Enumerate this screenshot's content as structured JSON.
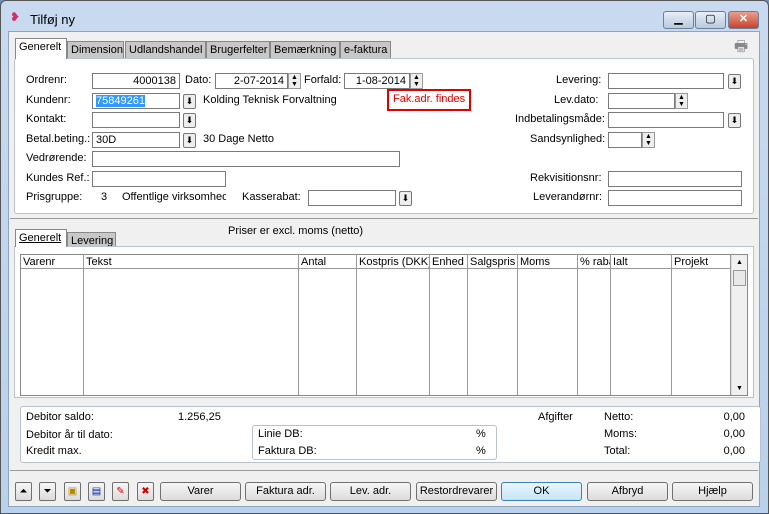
{
  "window": {
    "title": "Tilføj ny",
    "minimize": "▁",
    "maximize": "▢",
    "close": "✕"
  },
  "top_tabs": [
    "Generelt",
    "Dimension",
    "Udlandshandel",
    "Brugerfelter",
    "Bemærkning",
    "e-faktura"
  ],
  "form": {
    "ordrenr_label": "Ordrenr:",
    "ordrenr": "4000138",
    "dato_label": "Dato:",
    "dato": "2-07-2014",
    "forfald_label": "Forfald:",
    "forfald": "1-08-2014",
    "kundenr_label": "Kundenr:",
    "kundenr": "75849261",
    "kunde_navn": "Kolding Teknisk Forvaltning",
    "fak_adr": "Fak.adr. findes",
    "kontakt_label": "Kontakt:",
    "kontakt": "",
    "betal_label": "Betal.beting.:",
    "betal": "30D",
    "betal_tekst": "30 Dage Netto",
    "vedr_label": "Vedrørende:",
    "vedr": "",
    "kref_label": "Kundes Ref.:",
    "kref": "",
    "prisgruppe_label": "Prisgruppe:",
    "prisgruppe": "3",
    "prisgruppe_tekst": "Offentlige virksomhed",
    "kasserabat_label": "Kasserabat:",
    "kasserabat": "",
    "levering_label": "Levering:",
    "levdato_label": "Lev.dato:",
    "indbetaling_label": "Indbetalingsmåde:",
    "sandsyn_label": "Sandsynlighed:",
    "rekv_label": "Rekvisitionsnr:",
    "leverandor_label": "Leverandørnr:"
  },
  "lower_tabs": [
    "Generelt",
    "Levering"
  ],
  "price_note": "Priser er excl. moms (netto)",
  "columns": [
    "Varenr",
    "Tekst",
    "Antal",
    "Kostpris (DKK)",
    "Enhed",
    "Salgspris",
    "Moms",
    "% rabat",
    "Ialt",
    "Projekt"
  ],
  "summary": {
    "saldo_label": "Debitor saldo:",
    "saldo": "1.256,25",
    "aar_label": "Debitor år til dato:",
    "kredit_label": "Kredit max.",
    "linie_db": "Linie DB:",
    "faktura_db": "Faktura DB:",
    "pct": "%",
    "afgifter": "Afgifter",
    "netto_label": "Netto:",
    "netto": "0,00",
    "moms_label": "Moms:",
    "moms": "0,00",
    "total_label": "Total:",
    "total": "0,00"
  },
  "buttons": [
    "Varer",
    "Faktura adr.",
    "Lev. adr.",
    "Restordrevarer",
    "OK",
    "Afbryd",
    "Hjælp"
  ],
  "accent_red": "#e00000"
}
